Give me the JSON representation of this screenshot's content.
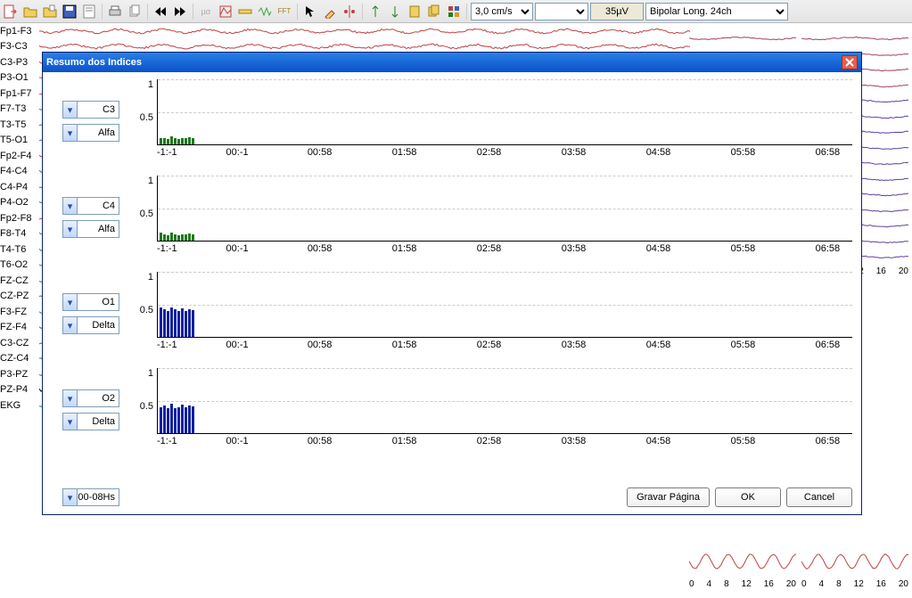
{
  "toolbar": {
    "speed_options": [
      "3,0 cm/s"
    ],
    "speed_value": "3,0 cm/s",
    "empty_value": "",
    "sensitivity": "35µV",
    "montage_options": [
      "Bipolar Long. 24ch"
    ],
    "montage_value": "Bipolar Long. 24ch"
  },
  "channels": [
    "Fp1-F3",
    "F3-C3",
    "C3-P3",
    "P3-O1",
    "Fp1-F7",
    "F7-T3",
    "T3-T5",
    "T5-O1",
    "Fp2-F4",
    "F4-C4",
    "C4-P4",
    "P4-O2",
    "Fp2-F8",
    "F8-T4",
    "T4-T6",
    "T6-O2",
    "FZ-CZ",
    "CZ-PZ",
    "F3-FZ",
    "FZ-F4",
    "C3-CZ",
    "CZ-C4",
    "P3-PZ",
    "PZ-P4",
    "EKG"
  ],
  "modal": {
    "title": "Resumo dos Indices",
    "time_range": "00-08Hs",
    "buttons": {
      "save": "Gravar Página",
      "ok": "OK",
      "cancel": "Cancel"
    }
  },
  "x_ticks": [
    "-1:-1",
    "00:-1",
    "00:58",
    "01:58",
    "02:58",
    "03:58",
    "04:58",
    "05:58",
    "06:58"
  ],
  "y_ticks": [
    "1",
    "0.5"
  ],
  "chart_data": [
    {
      "type": "bar",
      "channel": "C3",
      "band": "Alfa",
      "color": "#1a7a1a",
      "title": "",
      "xlabel": "",
      "ylabel": "",
      "ylim": [
        0,
        1
      ],
      "x_categories": [
        "-1:-1",
        "00:-1",
        "00:58",
        "01:58",
        "02:58",
        "03:58",
        "04:58",
        "05:58",
        "06:58"
      ],
      "values": [
        0.1,
        0.1,
        0.08,
        0.12,
        0.1,
        0.08,
        0.1,
        0.09,
        0.11,
        0.1
      ]
    },
    {
      "type": "bar",
      "channel": "C4",
      "band": "Alfa",
      "color": "#1a7a1a",
      "title": "",
      "xlabel": "",
      "ylabel": "",
      "ylim": [
        0,
        1
      ],
      "x_categories": [
        "-1:-1",
        "00:-1",
        "00:58",
        "01:58",
        "02:58",
        "03:58",
        "04:58",
        "05:58",
        "06:58"
      ],
      "values": [
        0.12,
        0.1,
        0.08,
        0.12,
        0.1,
        0.08,
        0.1,
        0.09,
        0.11,
        0.1
      ]
    },
    {
      "type": "bar",
      "channel": "O1",
      "band": "Delta",
      "color": "#1020a0",
      "title": "",
      "xlabel": "",
      "ylabel": "",
      "ylim": [
        0,
        1
      ],
      "x_categories": [
        "-1:-1",
        "00:-1",
        "00:58",
        "01:58",
        "02:58",
        "03:58",
        "04:58",
        "05:58",
        "06:58"
      ],
      "values": [
        0.45,
        0.42,
        0.4,
        0.45,
        0.43,
        0.4,
        0.44,
        0.4,
        0.42,
        0.41
      ]
    },
    {
      "type": "bar",
      "channel": "O2",
      "band": "Delta",
      "color": "#1020a0",
      "title": "",
      "xlabel": "",
      "ylabel": "",
      "ylim": [
        0,
        1
      ],
      "x_categories": [
        "-1:-1",
        "00:-1",
        "00:58",
        "01:58",
        "02:58",
        "03:58",
        "04:58",
        "05:58",
        "06:58"
      ],
      "values": [
        0.4,
        0.42,
        0.38,
        0.45,
        0.38,
        0.4,
        0.44,
        0.4,
        0.42,
        0.41
      ]
    }
  ],
  "side_axis_ticks": [
    "0",
    "4",
    "8",
    "12",
    "16",
    "20"
  ],
  "side_axis_ticks2": [
    "2",
    "16",
    "20"
  ]
}
